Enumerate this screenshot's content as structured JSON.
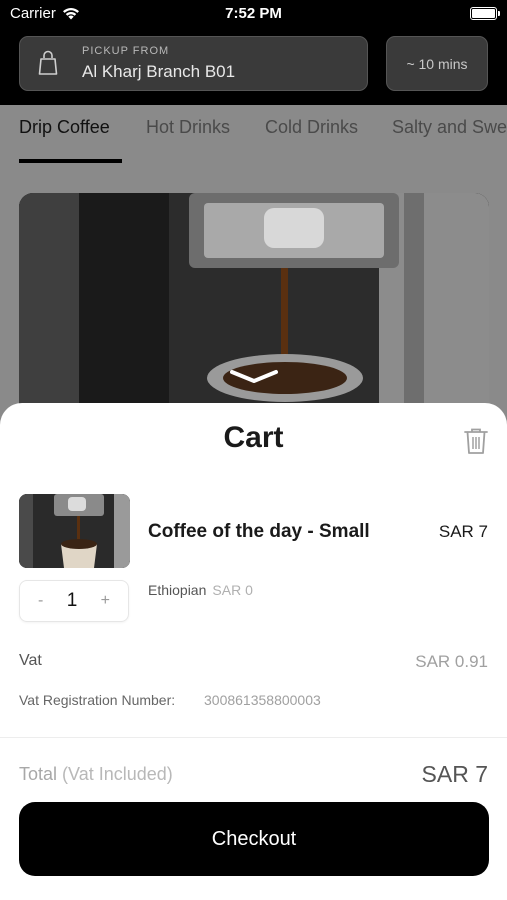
{
  "status_bar": {
    "carrier": "Carrier",
    "time": "7:52 PM"
  },
  "header": {
    "pickup_label": "PICKUP FROM",
    "branch_name": "Al Kharj Branch B01",
    "eta": "~ 10 mins"
  },
  "tabs": [
    {
      "label": "Drip Coffee",
      "active": true
    },
    {
      "label": "Hot Drinks",
      "active": false
    },
    {
      "label": "Cold Drinks",
      "active": false
    },
    {
      "label": "Salty and Sweets",
      "active": false
    }
  ],
  "cart": {
    "title": "Cart",
    "item": {
      "name": "Coffee of the day - Small",
      "price": "SAR 7",
      "quantity": "1",
      "minus": "-",
      "plus": "+",
      "option_name": "Ethiopian",
      "option_price": "SAR 0"
    },
    "vat_label": "Vat",
    "vat_value": "SAR 0.91",
    "vat_reg_label": "Vat Registration Number:",
    "vat_reg_number": "300861358800003",
    "total_label": "Total",
    "total_sublabel": "(Vat Included)",
    "total_value": "SAR 7",
    "checkout_label": "Checkout"
  },
  "icons": [
    "wifi-icon",
    "battery-icon",
    "bag-icon",
    "trash-icon",
    "chevron-down-icon"
  ],
  "colors": {
    "primary": "#000000",
    "sheet": "#ffffff",
    "overlay": "#8a8a8a"
  }
}
